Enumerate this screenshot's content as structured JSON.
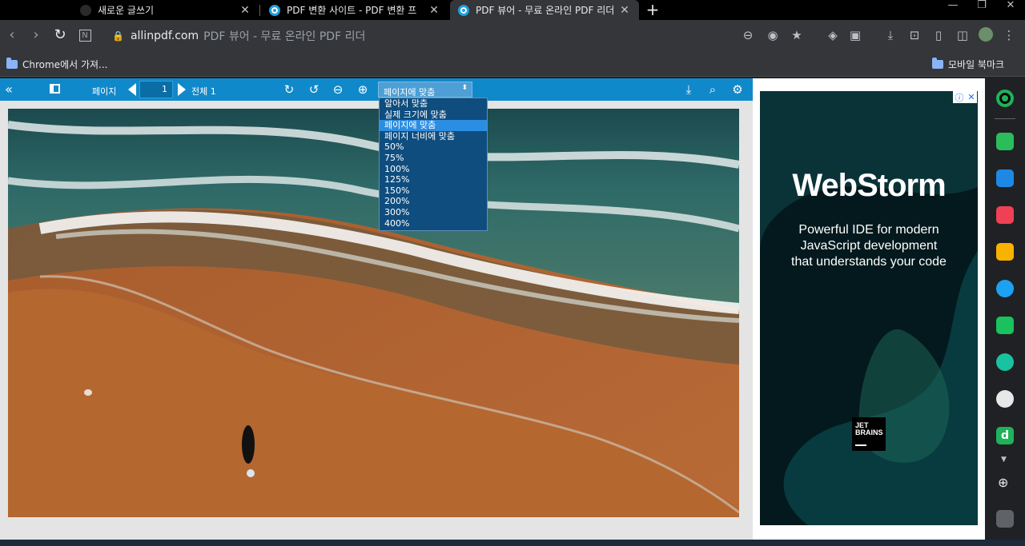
{
  "tabs": [
    {
      "title": "새로운 글쓰기",
      "active": false
    },
    {
      "title": "PDF 변환 사이트 - PDF 변환 프",
      "active": false
    },
    {
      "title": "PDF 뷰어 - 무료 온라인 PDF 리더",
      "active": true
    }
  ],
  "address": {
    "domain": "allinpdf.com",
    "page_title": "PDF 뷰어 - 무료 온라인 PDF 리더"
  },
  "bookmarks": {
    "left": "Chrome에서 가져...",
    "right": "모바일 북마크"
  },
  "viewer": {
    "page_label": "페이지",
    "page_number": "1",
    "total_label": "전체 1",
    "zoom_selected": "페이지에 맞춤",
    "zoom_options": [
      "알아서 맞춤",
      "실제 크기에 맞춤",
      "페이지에 맞춤",
      "페이지 너비에 맞춤",
      "50%",
      "75%",
      "100%",
      "125%",
      "150%",
      "200%",
      "300%",
      "400%"
    ]
  },
  "ad": {
    "title": "WebStorm",
    "description_lines": [
      "Powerful IDE for modern",
      "JavaScript development",
      "that understands your code"
    ],
    "logo_line1": "JET",
    "logo_line2": "BRAINS"
  },
  "colors": {
    "viewer_bar": "#1089ca",
    "dropdown_bg": "#0f4d7e",
    "dropdown_selected": "#2c8ee2",
    "tab_active": "#35363a"
  }
}
